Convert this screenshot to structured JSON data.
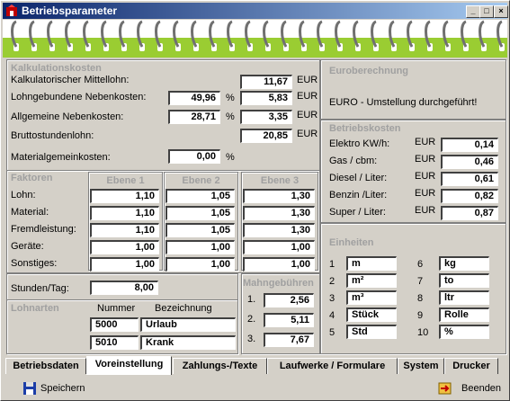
{
  "window": {
    "title": "Betriebsparameter",
    "minimize": "_",
    "maximize": "□",
    "close": "×"
  },
  "kalk": {
    "heading": "Kalkulationskosten",
    "mittellohn_label": "Kalkulatorischer Mittellohn:",
    "mittellohn": "11,67",
    "lohnneben_label": "Lohngebundene Nebenkosten:",
    "lohnneben_pct": "49,96",
    "lohnneben_eur": "5,83",
    "allg_label": "Allgemeine Nebenkosten:",
    "allg_pct": "28,71",
    "allg_eur": "3,35",
    "brutto_label": "Bruttostundenlohn:",
    "brutto": "20,85",
    "material_label": "Materialgemeinkosten:",
    "material_pct": "0,00",
    "eur": "EUR",
    "pct": "%"
  },
  "faktoren": {
    "heading": "Faktoren",
    "ebenen": [
      "Ebene 1",
      "Ebene 2",
      "Ebene 3"
    ],
    "rows": [
      {
        "label": "Lohn:",
        "values": [
          "1,10",
          "1,05",
          "1,30"
        ]
      },
      {
        "label": "Material:",
        "values": [
          "1,10",
          "1,05",
          "1,30"
        ]
      },
      {
        "label": "Fremdleistung:",
        "values": [
          "1,10",
          "1,05",
          "1,30"
        ]
      },
      {
        "label": "Geräte:",
        "values": [
          "1,00",
          "1,00",
          "1,00"
        ]
      },
      {
        "label": "Sonstiges:",
        "values": [
          "1,00",
          "1,00",
          "1,00"
        ]
      }
    ]
  },
  "stunden": {
    "label": "Stunden/Tag:",
    "value": "8,00"
  },
  "lohnarten": {
    "heading": "Lohnarten",
    "col_nummer": "Nummer",
    "col_bezeichnung": "Bezeichnung",
    "rows": [
      {
        "nummer": "5000",
        "bezeichnung": "Urlaub"
      },
      {
        "nummer": "5010",
        "bezeichnung": "Krank"
      }
    ]
  },
  "mahn": {
    "heading": "Mahngebühren",
    "rows": [
      {
        "label": "1.",
        "value": "2,56"
      },
      {
        "label": "2.",
        "value": "5,11"
      },
      {
        "label": "3.",
        "value": "7,67"
      }
    ]
  },
  "euro": {
    "heading": "Euroberechnung",
    "status": "EURO - Umstellung durchgeführt!"
  },
  "betrieb": {
    "heading": "Betriebskosten",
    "rows": [
      {
        "label": "Elektro KW/h:",
        "unit": "EUR",
        "value": "0,14"
      },
      {
        "label": "Gas / cbm:",
        "unit": "EUR",
        "value": "0,46"
      },
      {
        "label": "Diesel / Liter:",
        "unit": "EUR",
        "value": "0,61"
      },
      {
        "label": "Benzin /Liter:",
        "unit": "EUR",
        "value": "0,82"
      },
      {
        "label": "Super / Liter:",
        "unit": "EUR",
        "value": "0,87"
      }
    ]
  },
  "einheiten": {
    "heading": "Einheiten",
    "left": [
      {
        "num": "1",
        "value": "m"
      },
      {
        "num": "2",
        "value": "m²"
      },
      {
        "num": "3",
        "value": "m³"
      },
      {
        "num": "4",
        "value": "Stück"
      },
      {
        "num": "5",
        "value": "Std"
      }
    ],
    "right": [
      {
        "num": "6",
        "value": "kg"
      },
      {
        "num": "7",
        "value": "to"
      },
      {
        "num": "8",
        "value": "ltr"
      },
      {
        "num": "9",
        "value": "Rolle"
      },
      {
        "num": "10",
        "value": "%"
      }
    ]
  },
  "tabs": [
    "Betriebsdaten",
    "Voreinstellung",
    "Zahlungs-/Texte",
    "Laufwerke / Formulare",
    "System",
    "Drucker"
  ],
  "buttons": {
    "save": "Speichern",
    "exit": "Beenden"
  },
  "colors": {
    "title_start": "#0a246a",
    "title_end": "#a6caf0",
    "spiral": "#9acd32",
    "panel": "#d4d0c8"
  }
}
